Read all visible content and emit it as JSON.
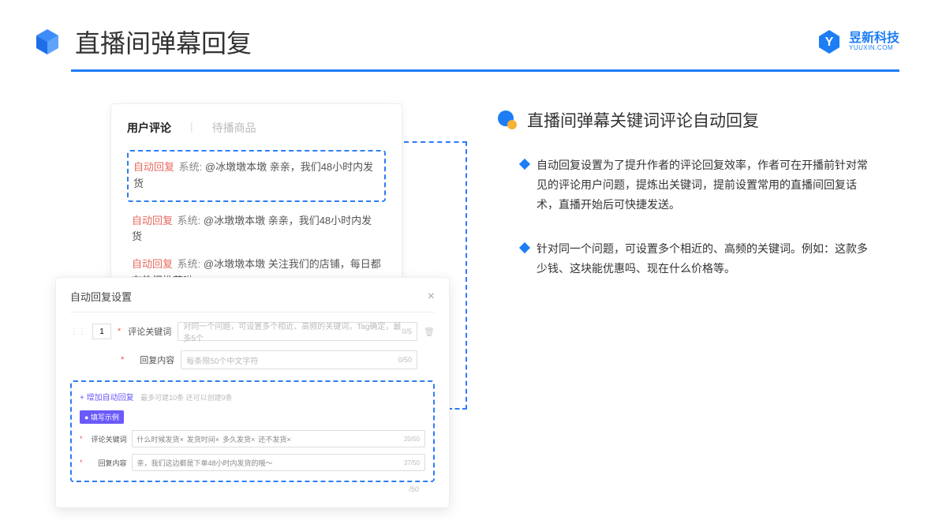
{
  "header": {
    "title": "直播间弹幕回复",
    "logo_cn": "昱新科技",
    "logo_en": "YUUXIN.COM"
  },
  "card1": {
    "tab_active": "用户评论",
    "tab_inactive": "待播商品",
    "auto_reply_label": "自动回复",
    "sys_label": "系统:",
    "highlighted": "@冰墩墩本墩 亲亲，我们48小时内发货",
    "c2": "@冰墩墩本墩 亲亲，我们48小时内发货",
    "c3": "@冰墩墩本墩 关注我们的店铺，每日都有热门推荐呦～"
  },
  "card2": {
    "title": "自动回复设置",
    "num": "1",
    "label1": "评论关键词",
    "placeholder1": "对同一个问题，可设置多个相近、高频的关键词，Tag确定，最多5个",
    "counter1": "0/5",
    "label2": "回复内容",
    "placeholder2": "每条限50个中文字符",
    "counter2": "0/50",
    "add_link": "+ 增加自动回复",
    "add_hint": "最多可建10条 还可以创建9条",
    "badge": "● 填写示例",
    "ex_label1": "评论关键词",
    "ex_tags": [
      "什么时候发货×",
      "发货时间×",
      "多久发货×",
      "还不发货×"
    ],
    "ex_counter1": "20/50",
    "ex_label2": "回复内容",
    "ex_value2": "亲，我们这边都是下单48小时内发货的哦～",
    "ex_counter2": "37/50",
    "outer_counter": "/50"
  },
  "right": {
    "heading": "直播间弹幕关键词评论自动回复",
    "b1": "自动回复设置为了提升作者的评论回复效率，作者可在开播前针对常见的评论用户问题，提炼出关键词，提前设置常用的直播间回复话术，直播开始后可快捷发送。",
    "b2": "针对同一个问题，可设置多个相近的、高频的关键词。例如：这款多少钱、这块能优惠吗、现在什么价格等。"
  }
}
